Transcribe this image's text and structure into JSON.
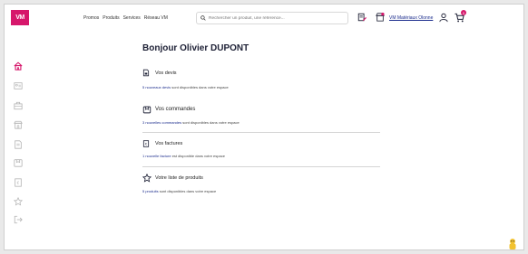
{
  "header": {
    "logo_text": "VM",
    "nav": [
      {
        "label": "Promos"
      },
      {
        "label": "Produits"
      },
      {
        "label": "Services"
      },
      {
        "label": "Réseau VM"
      }
    ],
    "search_placeholder": "Rechercher un produit, une référence...",
    "store_link": "VM Matériaux Olonne",
    "cart_badge": "0",
    "brand_color": "#d6176b",
    "link_color": "#1a2b8c"
  },
  "sidebar": {
    "items": [
      {
        "icon": "home-icon",
        "active": true
      },
      {
        "icon": "id-card-icon"
      },
      {
        "icon": "briefcase-icon"
      },
      {
        "icon": "store-icon"
      },
      {
        "icon": "document-icon"
      },
      {
        "icon": "box-icon"
      },
      {
        "icon": "invoice-icon"
      },
      {
        "icon": "star-icon"
      },
      {
        "icon": "logout-icon"
      }
    ]
  },
  "main": {
    "greeting": "Bonjour Olivier DUPONT",
    "sections": [
      {
        "title": "Vos devis",
        "desc_link": "5 nouveaux devis",
        "desc_rest": " sont disponibles dans votre espace",
        "icon": "quote-document-icon"
      },
      {
        "title": "Vos commandes",
        "desc_link": "3 nouvelles commandes",
        "desc_rest": " sont disponibles dans votre espace",
        "icon": "box-icon"
      },
      {
        "title": "Vos factures",
        "desc_link": "1 nouvelle facture",
        "desc_rest": " est disponible dans votre espace",
        "icon": "invoice-icon"
      },
      {
        "title": "Votre liste de produits",
        "desc_link": "5 produits",
        "desc_rest": " sont disponibles dans votre espace",
        "icon": "star-icon"
      }
    ]
  }
}
